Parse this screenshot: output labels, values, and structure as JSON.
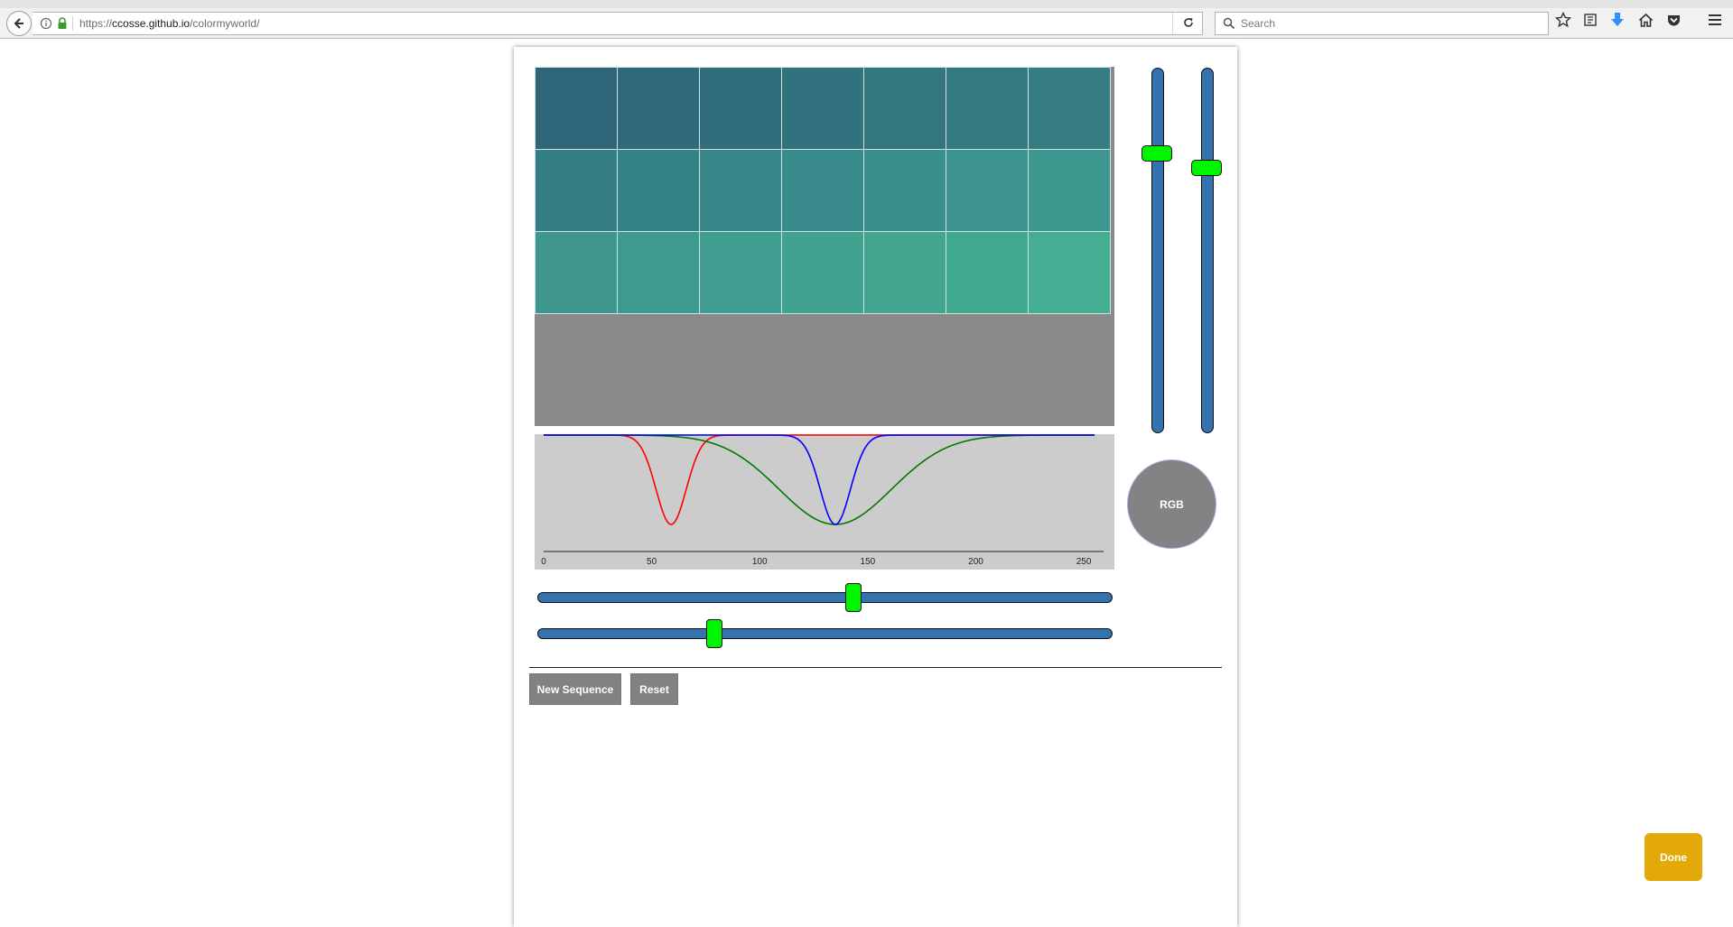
{
  "browser": {
    "url_prefix": "https://",
    "url_host": "ccosse.github.io",
    "url_path": "/colormyworld/",
    "search_placeholder": "Search",
    "toolbar_icons": [
      "star-icon",
      "reading-list-icon",
      "download-icon",
      "home-icon",
      "pocket-icon",
      "menu-icon"
    ]
  },
  "colors": {
    "slider_track": "#3273b0",
    "slider_thumb": "#00f600",
    "graph_background": "#cccccc",
    "grid_background": "#898989",
    "done_button": "#e3a908",
    "curve_red": "#ff0000",
    "curve_green": "#007a00",
    "curve_blue": "#0000ff"
  },
  "swatch_grid": {
    "rows": 3,
    "cols": 7,
    "cells": [
      [
        "#2e6578",
        "#2f6a7a",
        "#316e7c",
        "#32727e",
        "#337680",
        "#347a81",
        "#357d82"
      ],
      [
        "#347d82",
        "#358285",
        "#378788",
        "#388b8a",
        "#3a8f8c",
        "#3c938d",
        "#3d978e"
      ],
      [
        "#3e968d",
        "#3e9a8e",
        "#3f9e8f",
        "#40a28f",
        "#41a590",
        "#42a991",
        "#44ae92"
      ]
    ]
  },
  "graph": {
    "x_ticks": [
      "0",
      "50",
      "100",
      "150",
      "200",
      "250"
    ],
    "x_range": [
      0,
      260
    ],
    "curves": [
      {
        "channel": "red",
        "center": 59,
        "width": 7,
        "depth": 1.0
      },
      {
        "channel": "green",
        "center": 135,
        "width": 26,
        "depth": 1.0
      },
      {
        "channel": "blue",
        "center": 135,
        "width": 7,
        "depth": 1.0
      }
    ]
  },
  "sliders": {
    "horizontal_1_value": 0.55,
    "horizontal_2_value": 0.3,
    "vertical_1_value": 0.78,
    "vertical_2_value": 0.74
  },
  "buttons": {
    "rgb": "RGB",
    "new_sequence": "New Sequence",
    "reset": "Reset",
    "done": "Done"
  }
}
